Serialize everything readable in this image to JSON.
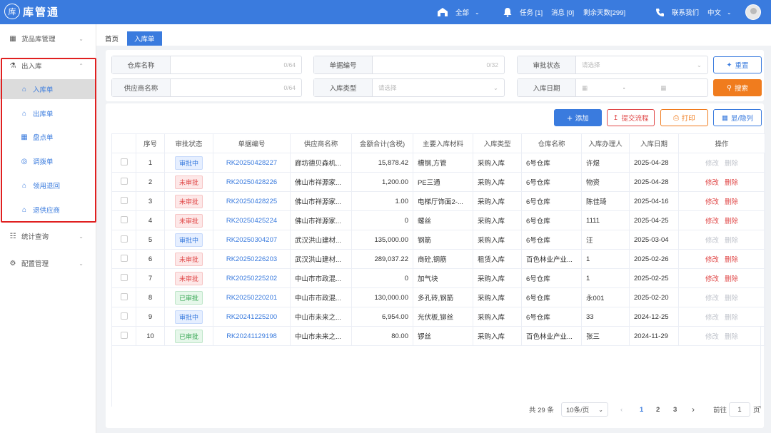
{
  "app": {
    "title": "库管通",
    "logo_glyph": "库"
  },
  "header": {
    "warehouse_select": "全部",
    "tasks": "任务 [1]",
    "messages": "消息 [0]",
    "remaining_days": "剩余天数[299]",
    "contact": "联系我们",
    "language": "中文"
  },
  "sidebar": {
    "goods": "货品库管理",
    "inout": "出入库",
    "items": [
      "入库单",
      "出库单",
      "盘点单",
      "调拨单",
      "领用退回",
      "退供应商"
    ],
    "stats": "统计查询",
    "config": "配置管理"
  },
  "tabs": [
    "首页",
    "入库单"
  ],
  "filters": {
    "warehouse_name": {
      "label": "仓库名称",
      "count": "0/64"
    },
    "doc_no": {
      "label": "单据编号",
      "count": "0/32"
    },
    "approval_status": {
      "label": "审批状态",
      "placeholder": "请选择"
    },
    "supplier_name": {
      "label": "供应商名称",
      "count": "0/64"
    },
    "inbound_type": {
      "label": "入库类型",
      "placeholder": "请选择"
    },
    "inbound_date": {
      "label": "入库日期",
      "separator": "-"
    },
    "reset": "重置",
    "search": "搜索"
  },
  "toolbar": {
    "add": "添加",
    "submit_flow": "提交流程",
    "print": "打印",
    "columns": "显/隐列"
  },
  "table": {
    "headers": [
      "",
      "序号",
      "审批状态",
      "单据编号",
      "供应商名称",
      "金额合计(含税)",
      "主要入库材料",
      "入库类型",
      "仓库名称",
      "入库办理人",
      "入库日期",
      "操作"
    ],
    "edit": "修改",
    "delete": "删除",
    "rows": [
      {
        "no": "1",
        "status": "审批中",
        "kind": "pending",
        "doc": "RK20250428227",
        "supplier": "廊坊德贝森机...",
        "amount": "15,878.42",
        "material": "槽钢,方管",
        "type": "采购入库",
        "warehouse": "6号仓库",
        "handler": "许煜",
        "date": "2025-04-28",
        "editable": false
      },
      {
        "no": "2",
        "status": "未审批",
        "kind": "rejected",
        "doc": "RK20250428226",
        "supplier": "佛山市祥源家...",
        "amount": "1,200.00",
        "material": "PE三通",
        "type": "采购入库",
        "warehouse": "6号仓库",
        "handler": "物资",
        "date": "2025-04-28",
        "editable": true
      },
      {
        "no": "3",
        "status": "未审批",
        "kind": "rejected",
        "doc": "RK20250428225",
        "supplier": "佛山市祥源家...",
        "amount": "1.00",
        "material": "电梯厅饰面2-...",
        "type": "采购入库",
        "warehouse": "6号仓库",
        "handler": "陈佳琦",
        "date": "2025-04-16",
        "editable": true
      },
      {
        "no": "4",
        "status": "未审批",
        "kind": "rejected",
        "doc": "RK20250425224",
        "supplier": "佛山市祥源家...",
        "amount": "0",
        "material": "螺丝",
        "type": "采购入库",
        "warehouse": "6号仓库",
        "handler": "1111",
        "date": "2025-04-25",
        "editable": true
      },
      {
        "no": "5",
        "status": "审批中",
        "kind": "pending",
        "doc": "RK20250304207",
        "supplier": "武汉洪山建材...",
        "amount": "135,000.00",
        "material": "钢筋",
        "type": "采购入库",
        "warehouse": "6号仓库",
        "handler": "汪",
        "date": "2025-03-04",
        "editable": false
      },
      {
        "no": "6",
        "status": "未审批",
        "kind": "rejected",
        "doc": "RK20250226203",
        "supplier": "武汉洪山建材...",
        "amount": "289,037.22",
        "material": "商砼,钢筋",
        "type": "租赁入库",
        "warehouse": "百色林业产业...",
        "handler": "1",
        "date": "2025-02-26",
        "editable": true
      },
      {
        "no": "7",
        "status": "未审批",
        "kind": "rejected",
        "doc": "RK20250225202",
        "supplier": "中山市市政混...",
        "amount": "0",
        "material": "加气块",
        "type": "采购入库",
        "warehouse": "6号仓库",
        "handler": "1",
        "date": "2025-02-25",
        "editable": true
      },
      {
        "no": "8",
        "status": "已审批",
        "kind": "approved",
        "doc": "RK20250220201",
        "supplier": "中山市市政混...",
        "amount": "130,000.00",
        "material": "多孔砖,钢筋",
        "type": "采购入库",
        "warehouse": "6号仓库",
        "handler": "永001",
        "date": "2025-02-20",
        "editable": false
      },
      {
        "no": "9",
        "status": "审批中",
        "kind": "pending",
        "doc": "RK20241225200",
        "supplier": "中山市未来之...",
        "amount": "6,954.00",
        "material": "光伏板,铆丝",
        "type": "采购入库",
        "warehouse": "6号仓库",
        "handler": "33",
        "date": "2024-12-25",
        "editable": false
      },
      {
        "no": "10",
        "status": "已审批",
        "kind": "approved",
        "doc": "RK20241129198",
        "supplier": "中山市未来之...",
        "amount": "80.00",
        "material": "锣丝",
        "type": "采购入库",
        "warehouse": "百色林业产业...",
        "handler": "张三",
        "date": "2024-11-29",
        "editable": false
      }
    ]
  },
  "pagination": {
    "total": "共 29 条",
    "page_size": "10条/页",
    "pages": [
      "1",
      "2",
      "3"
    ],
    "current": "1",
    "goto_label": "前往",
    "goto_value": "1",
    "page_unit": "页"
  },
  "colors": {
    "primary": "#3a7bde",
    "orange": "#f07c1e",
    "red": "#e04848",
    "highlight": "#e02020"
  }
}
